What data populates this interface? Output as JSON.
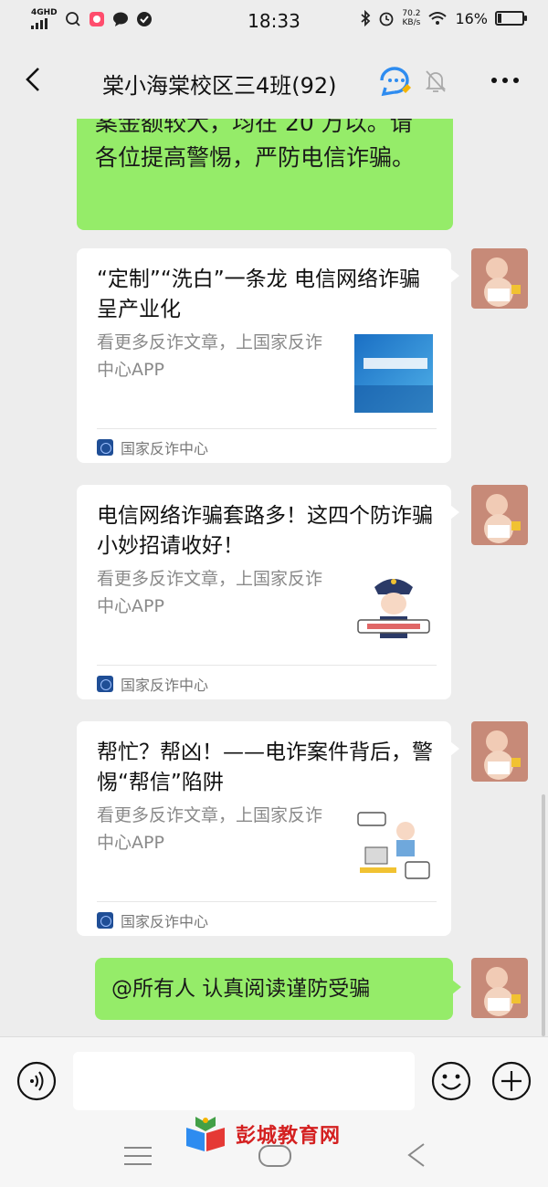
{
  "status_bar": {
    "network": "4GHD",
    "time": "18:33",
    "speed_value": "70.2",
    "speed_unit": "KB/s",
    "battery": "16%",
    "battery_level": 0.16
  },
  "header": {
    "title": "棠小海棠校区三4班(92)",
    "back_icon": "chevron-left-icon",
    "mute_icon": "bell-muted-icon",
    "more_icon": "more-icon"
  },
  "messages": {
    "top_text": "案金额较大，均在 20 万以。请各位提高警惕，严防电信诈骗。",
    "cards": [
      {
        "title": "“定制”“洗白”一条龙 电信网络诈骗呈产业化",
        "desc": "看更多反诈文章，上国家反诈中心APP",
        "source": "国家反诈中心",
        "thumb": "bank-card-thumbnail"
      },
      {
        "title": "电信网络诈骗套路多！这四个防诈骗小妙招请收好！",
        "desc": "看更多反诈文章，上国家反诈中心APP",
        "source": "国家反诈中心",
        "thumb": "police-officer-thumbnail"
      },
      {
        "title": "帮忙？帮凶！——电诈案件背后，警惕“帮信”陷阱",
        "desc": "看更多反诈文章，上国家反诈中心APP",
        "source": "国家反诈中心",
        "thumb": "cartoon-scene-thumbnail"
      }
    ],
    "last_text": "@所有人  认真阅读谨防受骗"
  },
  "input_bar": {
    "value": ""
  },
  "watermark": {
    "text": "彭城教育网"
  },
  "colors": {
    "bubble_green": "#95ec69",
    "background": "#ededed",
    "watermark_red": "#d42020"
  }
}
